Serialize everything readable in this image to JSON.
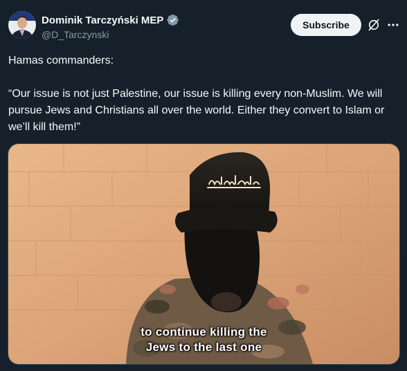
{
  "author": {
    "name": "Dominik Tarczyński MEP",
    "handle": "@D_Tarczynski",
    "avatar_icon": "profile-photo",
    "verified_icon": "verified-badge-icon",
    "verified_color": "#829aab"
  },
  "actions": {
    "subscribe_label": "Subscribe",
    "grok_icon": "grok-icon",
    "more_icon": "more-icon"
  },
  "tweet": {
    "text": "Hamas commanders:\n\n“Our issue is not just Palestine, our issue is killing every non-Muslim. We will pursue Jews and Christians all over the world. Either they convert to Islam or we’ll kill them!”"
  },
  "media": {
    "type": "video",
    "caption_line1": "to continue killing the",
    "caption_line2": "Jews to the last one",
    "cap_emblem_text": "لا إله إلا الله"
  },
  "colors": {
    "background": "#15202b",
    "text": "#f7f9f9",
    "secondary_text": "#8b98a5",
    "button_bg": "#eff3f4"
  }
}
